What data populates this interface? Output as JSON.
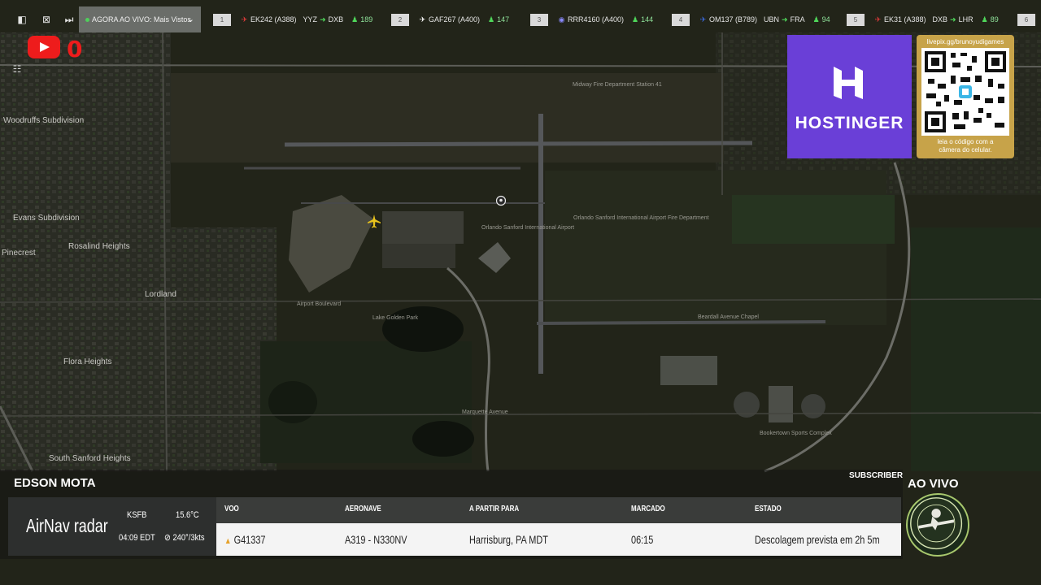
{
  "topbar": {
    "now_playing": "AGORA AO VIVO: Mais Vistos",
    "flights": [
      {
        "num": "1",
        "flight": "EK242 (A388)",
        "from": "YYZ",
        "to": "DXB",
        "pax": "189",
        "icon_color": "#e23b3b"
      },
      {
        "num": "2",
        "flight": "GAF267 (A400)",
        "from": "",
        "to": "",
        "pax": "147",
        "icon_color": "#ffffff"
      },
      {
        "num": "3",
        "flight": "RRR4160 (A400)",
        "from": "",
        "to": "",
        "pax": "144",
        "icon_color": "#6b6bff"
      },
      {
        "num": "4",
        "flight": "OM137 (B789)",
        "from": "UBN",
        "to": "FRA",
        "pax": "94",
        "icon_color": "#3b6be2"
      },
      {
        "num": "5",
        "flight": "EK31 (A388)",
        "from": "DXB",
        "to": "LHR",
        "pax": "89",
        "icon_color": "#e23b3b"
      },
      {
        "num": "6",
        "flight": "",
        "from": "",
        "to": "",
        "pax": "",
        "icon_color": "#ffffff"
      }
    ]
  },
  "youtube": {
    "count": "0"
  },
  "map_labels": [
    "Woodruffs Subdivision",
    "Evans Subdivision",
    "Rosalind Heights",
    "Pinecrest",
    "Lordland",
    "Flora Heights",
    "South Sanford Heights",
    "Lake Golden Park",
    "Orlando Sanford International Airport",
    "Midway Fire Department Station 41",
    "Orlando Sanford International Airport Fire Department",
    "Beardall Avenue Chapel",
    "Bookertown Sports Complex",
    "Airport Boulevard",
    "Marquette Avenue"
  ],
  "ad": {
    "brand": "HOSTINGER",
    "qr_url": "livepix.gg/brunoyudigames",
    "qr_caption_1": "leia o código com a",
    "qr_caption_2": "câmera do celular."
  },
  "panel": {
    "streamer": "EDSON MOTA",
    "subscriber": "SUBSCRIBER",
    "live": "AO VIVO",
    "airnav_brand": "AirNav",
    "airnav_radar": " radar",
    "icao": "KSFB",
    "temp": "15.6°C",
    "time": "04:09 EDT",
    "wind": "240°/3kts",
    "headers": {
      "voo": "VOO",
      "aeronave": "AERONAVE",
      "partir": "A PARTIR PARA",
      "marcado": "MARCADO",
      "estado": "ESTADO"
    },
    "row": {
      "voo": "G41337",
      "aeronave": "A319 - N330NV",
      "partir": "Harrisburg, PA MDT",
      "marcado": "06:15",
      "estado": "Descolagem prevista em 2h 5m"
    }
  },
  "colors": {
    "accent_green": "#4fd65a",
    "youtube_red": "#ee1c1c",
    "hostinger_purple": "#6a3fd7",
    "qr_gold": "#c7a349"
  }
}
